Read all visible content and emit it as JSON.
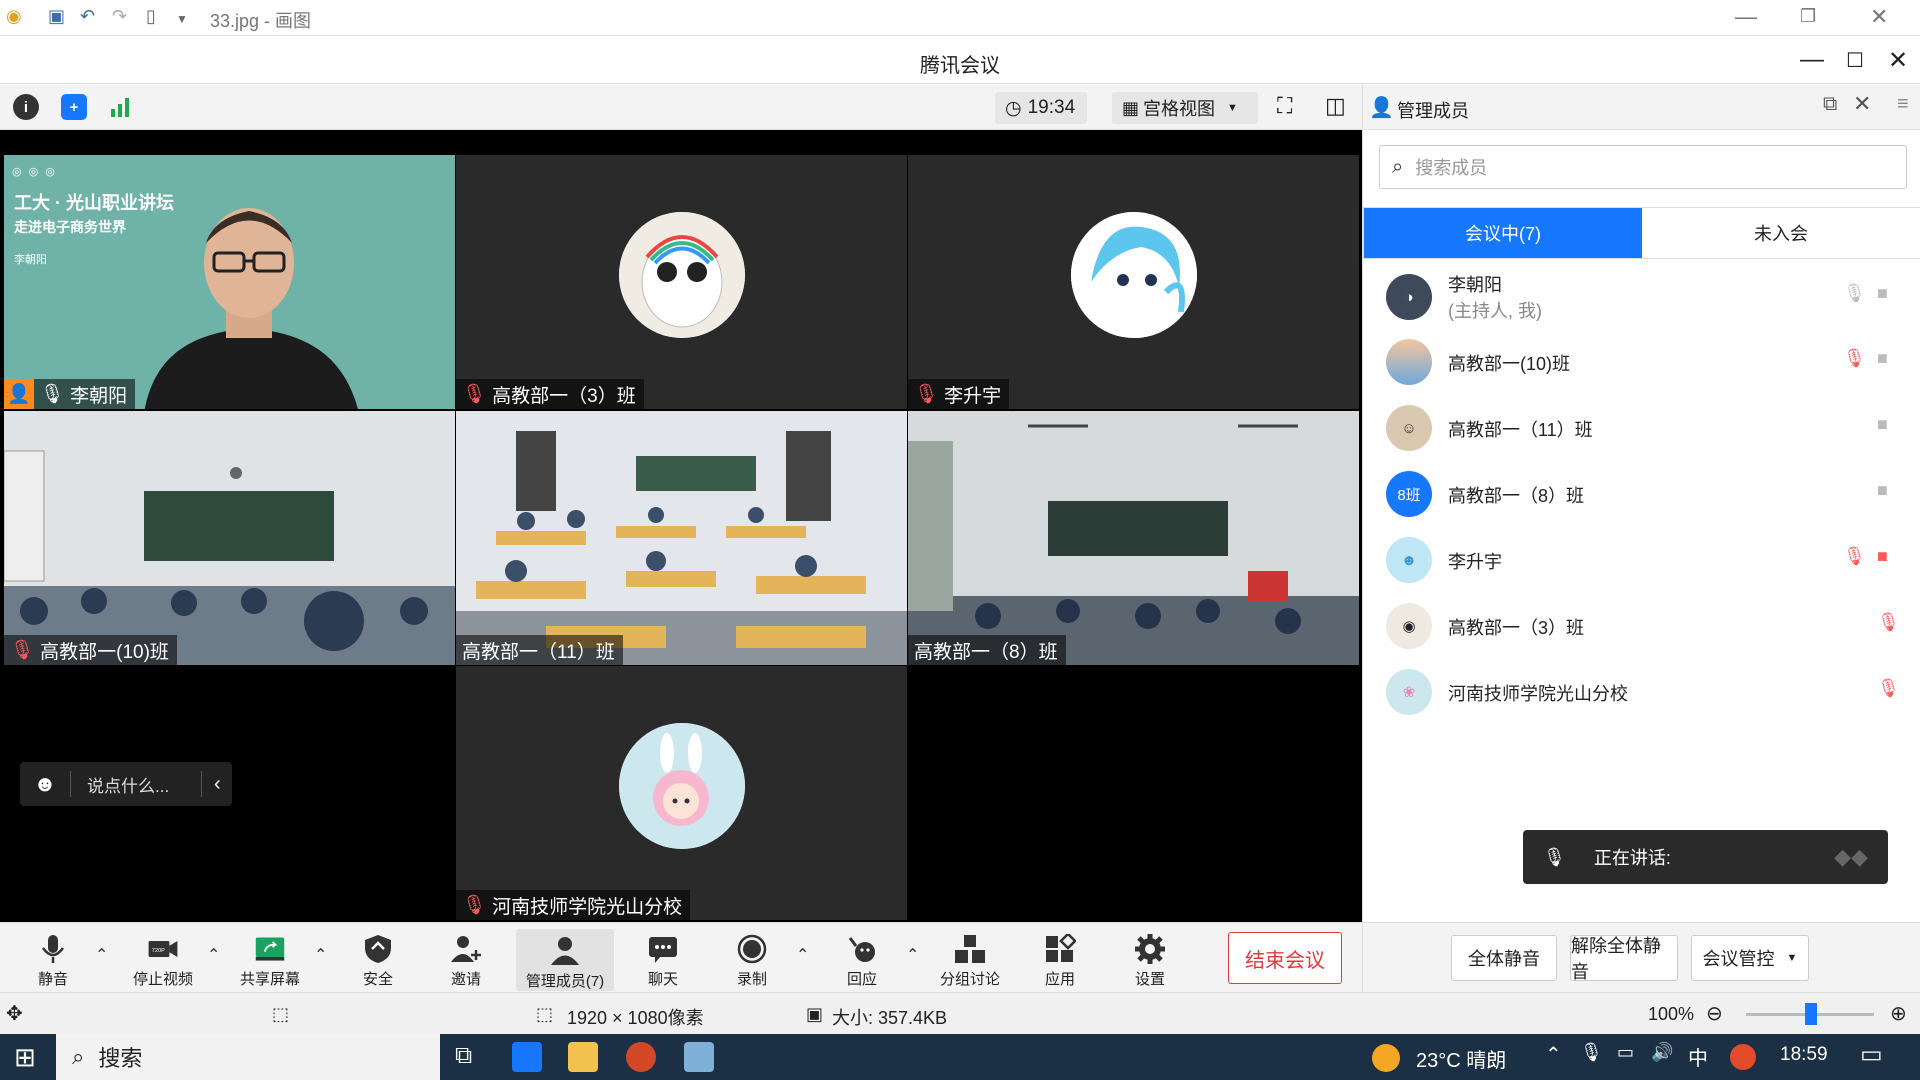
{
  "paint": {
    "title": "33.jpg - 画图",
    "status_size": "1920 × 1080像素",
    "status_filesize": "大小: 357.4KB",
    "zoom": "100%"
  },
  "meeting": {
    "window_title": "腾讯会议",
    "clock": "19:34",
    "view_mode": "宫格视图",
    "chat_placeholder": "说点什么...",
    "tiles": [
      {
        "name": "李朝阳",
        "muted": false,
        "type": "video"
      },
      {
        "name": "高教部一（3）班",
        "muted": true,
        "type": "avatar"
      },
      {
        "name": "李升宇",
        "muted": true,
        "type": "avatar"
      },
      {
        "name": "高教部一(10)班",
        "muted": true,
        "type": "video"
      },
      {
        "name": "高教部一（11）班",
        "muted": false,
        "type": "video"
      },
      {
        "name": "高教部一（8）班",
        "muted": false,
        "type": "video"
      },
      {
        "name": "河南技师学院光山分校",
        "muted": true,
        "type": "avatar"
      }
    ],
    "controls": {
      "mute": "静音",
      "stop_video": "停止视频",
      "share": "共享屏幕",
      "security": "安全",
      "invite": "邀请",
      "members": "管理成员(7)",
      "chat": "聊天",
      "record": "录制",
      "reaction": "回应",
      "breakout": "分组讨论",
      "apps": "应用",
      "settings": "设置",
      "end": "结束会议",
      "video_badge": "720P"
    },
    "panel": {
      "title": "管理成员",
      "search_placeholder": "搜索成员",
      "tab_in": "会议中(7)",
      "tab_out": "未入会",
      "members": [
        {
          "name": "李朝阳",
          "sub": "(主持人, 我)"
        },
        {
          "name": "高教部一(10)班"
        },
        {
          "name": "高教部一（11）班"
        },
        {
          "name": "高教部一（8）班",
          "avatar_text": "8班"
        },
        {
          "name": "李升宇"
        },
        {
          "name": "高教部一（3）班"
        },
        {
          "name": "河南技师学院光山分校"
        }
      ],
      "speaking": "正在讲话:",
      "mute_all": "全体静音",
      "unmute_all": "解除全体静音",
      "manage": "会议管控"
    },
    "slide": {
      "line1": "工大 · 光山职业讲坛",
      "line2": "走进电子商务世界",
      "line3": "李朝阳"
    }
  },
  "taskbar": {
    "search": "搜索",
    "weather": "23°C 晴朗",
    "ime": "中",
    "time": "18:59"
  },
  "colors": {
    "accent": "#1677ff",
    "danger": "#e03b3b",
    "taskbar": "#1b3044"
  }
}
